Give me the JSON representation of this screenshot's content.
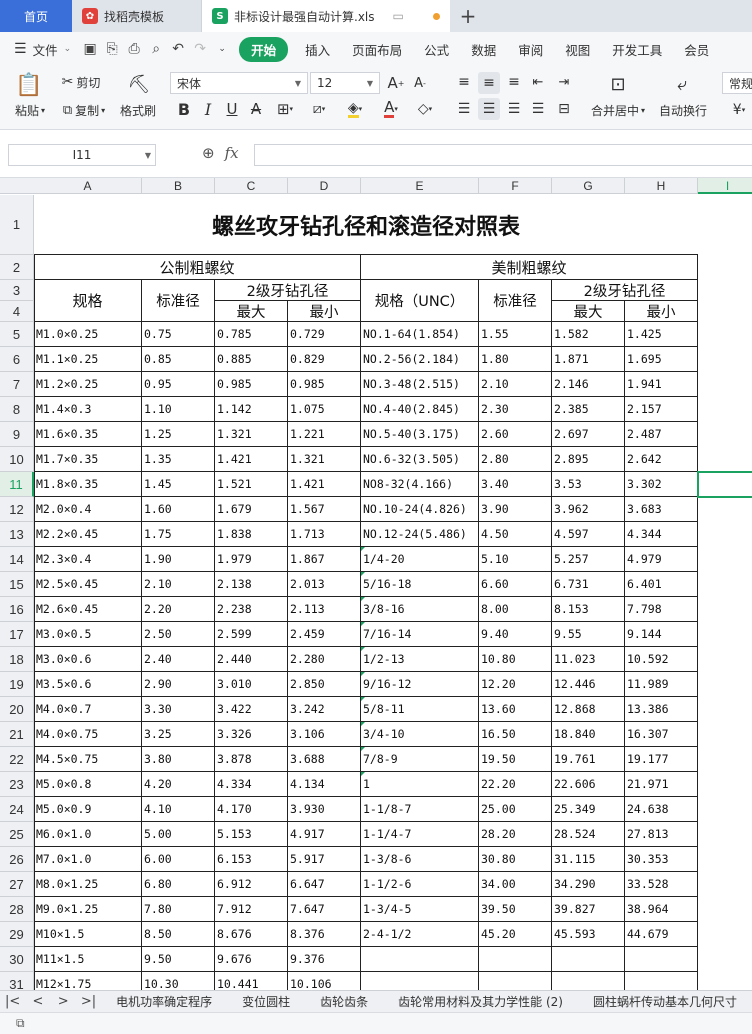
{
  "tabs": {
    "home": "首页",
    "template": "找稻壳模板",
    "file": "非标设计最强自动计算.xls"
  },
  "menu": {
    "file": "文件",
    "items": [
      "开始",
      "插入",
      "页面布局",
      "公式",
      "数据",
      "审阅",
      "视图",
      "开发工具",
      "会员"
    ]
  },
  "ribbon": {
    "paste": "粘贴",
    "cut": "剪切",
    "copy": "复制",
    "format_painter": "格式刷",
    "font_name": "宋体",
    "font_size": "12",
    "merge": "合并居中",
    "wrap": "自动换行",
    "number_format": "常规",
    "currency": "¥"
  },
  "formula_bar": {
    "cell_ref": "I11",
    "fx": "fx"
  },
  "columns": [
    "A",
    "B",
    "C",
    "D",
    "E",
    "F",
    "G",
    "H",
    "I"
  ],
  "rows": [
    "1",
    "2",
    "3",
    "4",
    "5",
    "6",
    "7",
    "8",
    "9",
    "10",
    "11",
    "12",
    "13",
    "14",
    "15",
    "16",
    "17",
    "18",
    "19",
    "20",
    "21",
    "22",
    "23",
    "24",
    "25",
    "26",
    "27",
    "28",
    "29",
    "30",
    "31"
  ],
  "sheet": {
    "title": "螺丝攻牙钻孔径和滚造径对照表",
    "metric_header": "公制粗螺纹",
    "imperial_header": "美制粗螺纹",
    "spec": "规格",
    "spec_unc": "规格（UNC）",
    "std_dia": "标准径",
    "drill": "2级牙钻孔径",
    "max": "最大",
    "min": "最小",
    "data": [
      [
        "M1.0×0.25",
        "0.75",
        "0.785",
        "0.729",
        "NO.1-64(1.854)",
        "1.55",
        "1.582",
        "1.425"
      ],
      [
        "M1.1×0.25",
        "0.85",
        "0.885",
        "0.829",
        "NO.2-56(2.184)",
        "1.80",
        "1.871",
        "1.695"
      ],
      [
        "M1.2×0.25",
        "0.95",
        "0.985",
        "0.985",
        "NO.3-48(2.515)",
        "2.10",
        "2.146",
        "1.941"
      ],
      [
        "M1.4×0.3",
        "1.10",
        "1.142",
        "1.075",
        "NO.4-40(2.845)",
        "2.30",
        "2.385",
        "2.157"
      ],
      [
        "M1.6×0.35",
        "1.25",
        "1.321",
        "1.221",
        "NO.5-40(3.175)",
        "2.60",
        "2.697",
        "2.487"
      ],
      [
        "M1.7×0.35",
        "1.35",
        "1.421",
        "1.321",
        "NO.6-32(3.505)",
        "2.80",
        "2.895",
        "2.642"
      ],
      [
        "M1.8×0.35",
        "1.45",
        "1.521",
        "1.421",
        "NO8-32(4.166)",
        "3.40",
        "3.53",
        "3.302"
      ],
      [
        "M2.0×0.4",
        "1.60",
        "1.679",
        "1.567",
        "NO.10-24(4.826)",
        "3.90",
        "3.962",
        "3.683"
      ],
      [
        "M2.2×0.45",
        "1.75",
        "1.838",
        "1.713",
        "NO.12-24(5.486)",
        "4.50",
        "4.597",
        "4.344"
      ],
      [
        "M2.3×0.4",
        "1.90",
        "1.979",
        "1.867",
        "1/4-20",
        "5.10",
        "5.257",
        "4.979"
      ],
      [
        "M2.5×0.45",
        "2.10",
        "2.138",
        "2.013",
        "5/16-18",
        "6.60",
        "6.731",
        "6.401"
      ],
      [
        "M2.6×0.45",
        "2.20",
        "2.238",
        "2.113",
        "3/8-16",
        "8.00",
        "8.153",
        "7.798"
      ],
      [
        "M3.0×0.5",
        "2.50",
        "2.599",
        "2.459",
        "7/16-14",
        "9.40",
        "9.55",
        "9.144"
      ],
      [
        "M3.0×0.6",
        "2.40",
        "2.440",
        "2.280",
        "1/2-13",
        "10.80",
        "11.023",
        "10.592"
      ],
      [
        "M3.5×0.6",
        "2.90",
        "3.010",
        "2.850",
        "9/16-12",
        "12.20",
        "12.446",
        "11.989"
      ],
      [
        "M4.0×0.7",
        "3.30",
        "3.422",
        "3.242",
        "5/8-11",
        "13.60",
        "12.868",
        "13.386"
      ],
      [
        "M4.0×0.75",
        "3.25",
        "3.326",
        "3.106",
        "3/4-10",
        "16.50",
        "18.840",
        "16.307"
      ],
      [
        "M4.5×0.75",
        "3.80",
        "3.878",
        "3.688",
        "7/8-9",
        "19.50",
        "19.761",
        "19.177"
      ],
      [
        "M5.0×0.8",
        "4.20",
        "4.334",
        "4.134",
        "1",
        "22.20",
        "22.606",
        "21.971"
      ],
      [
        "M5.0×0.9",
        "4.10",
        "4.170",
        "3.930",
        "1-1/8-7",
        "25.00",
        "25.349",
        "24.638"
      ],
      [
        "M6.0×1.0",
        "5.00",
        "5.153",
        "4.917",
        "1-1/4-7",
        "28.20",
        "28.524",
        "27.813"
      ],
      [
        "M7.0×1.0",
        "6.00",
        "6.153",
        "5.917",
        "1-3/8-6",
        "30.80",
        "31.115",
        "30.353"
      ],
      [
        "M8.0×1.25",
        "6.80",
        "6.912",
        "6.647",
        "1-1/2-6",
        "34.00",
        "34.290",
        "33.528"
      ],
      [
        "M9.0×1.25",
        "7.80",
        "7.912",
        "7.647",
        "1-3/4-5",
        "39.50",
        "39.827",
        "38.964"
      ],
      [
        "M10×1.5",
        "8.50",
        "8.676",
        "8.376",
        "2-4-1/2",
        "45.20",
        "45.593",
        "44.679"
      ],
      [
        "M11×1.5",
        "9.50",
        "9.676",
        "9.376",
        "",
        "",
        "",
        ""
      ],
      [
        "M12×1.75",
        "10.30",
        "10.441",
        "10.106",
        "",
        "",
        "",
        ""
      ]
    ]
  },
  "sheet_tabs": [
    "电机功率确定程序",
    "变位圆柱",
    "齿轮齿条",
    "齿轮常用材料及其力学性能 (2)",
    "圆柱蜗杆传动基本几何尺寸"
  ],
  "colors": {
    "accent": "#1aa260",
    "home_tab": "#3a6fd9"
  }
}
